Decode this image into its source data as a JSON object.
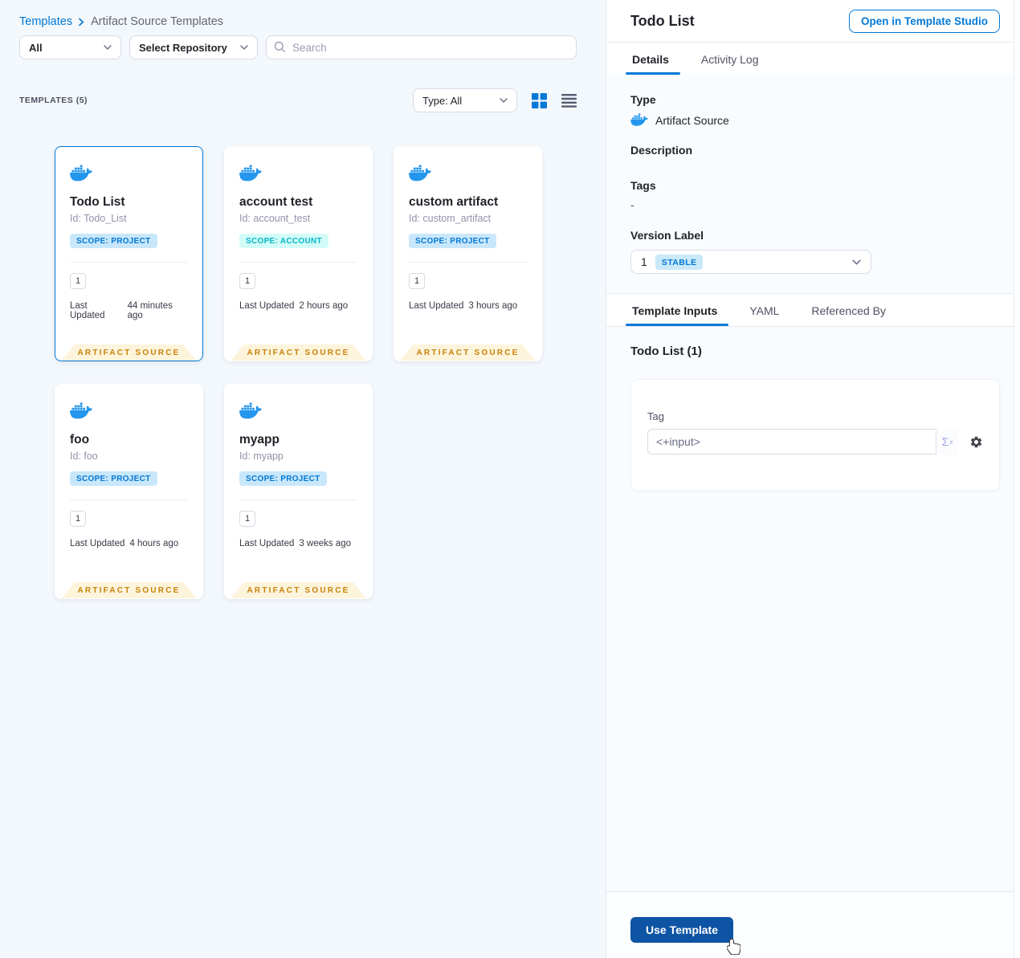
{
  "breadcrumb": {
    "link": "Templates",
    "current": "Artifact Source Templates"
  },
  "filters": {
    "scope_value": "All",
    "repository_value": "Select Repository",
    "search_placeholder": "Search"
  },
  "list_header": {
    "count": "TEMPLATES (5)",
    "type_filter": "Type: All"
  },
  "cards_common": {
    "last_updated_label": "Last Updated",
    "ribbon": "ARTIFACT SOURCE"
  },
  "cards": [
    {
      "title": "Todo List",
      "id": "Id: Todo_List",
      "scope": "SCOPE: PROJECT",
      "scope_type": "project",
      "version_count": "1",
      "last_updated": "44 minutes ago",
      "selected": true
    },
    {
      "title": "account test",
      "id": "Id: account_test",
      "scope": "SCOPE: ACCOUNT",
      "scope_type": "account",
      "version_count": "1",
      "last_updated": "2 hours ago",
      "selected": false
    },
    {
      "title": "custom artifact",
      "id": "Id: custom_artifact",
      "scope": "SCOPE: PROJECT",
      "scope_type": "project",
      "version_count": "1",
      "last_updated": "3 hours ago",
      "selected": false
    },
    {
      "title": "foo",
      "id": "Id: foo",
      "scope": "SCOPE: PROJECT",
      "scope_type": "project",
      "version_count": "1",
      "last_updated": "4 hours ago",
      "selected": false
    },
    {
      "title": "myapp",
      "id": "Id: myapp",
      "scope": "SCOPE: PROJECT",
      "scope_type": "project",
      "version_count": "1",
      "last_updated": "3 weeks ago",
      "selected": false
    }
  ],
  "panel": {
    "title": "Todo List",
    "open_button": "Open in Template Studio",
    "tabs": [
      "Details",
      "Activity Log"
    ],
    "details": {
      "type_label": "Type",
      "type_value": "Artifact Source",
      "description_label": "Description",
      "tags_label": "Tags",
      "tags_value": "-",
      "version_label": "Version Label",
      "version_value": "1",
      "version_badge": "STABLE"
    },
    "sub_tabs": [
      "Template Inputs",
      "YAML",
      "Referenced By"
    ],
    "inputs": {
      "heading": "Todo List (1)",
      "tag_label": "Tag",
      "tag_placeholder": "<+input>",
      "expression_sigma": "Σ",
      "expression_sup": "x"
    },
    "footer": {
      "use_template_label": "Use Template"
    }
  },
  "colors": {
    "primary_blue": "#0278d5",
    "docker_blue": "#2496ed",
    "use_template_button": "#0e54a4",
    "ribbon_bg": "#fdf4dc",
    "ribbon_text": "#c8830a",
    "scope_project_bg": "#c9e7fa",
    "scope_project_text": "#0278d5",
    "scope_account_bg": "#d3fcf8",
    "scope_account_text": "#06b7c4",
    "stable_badge_bg": "#c9e9f8",
    "stable_badge_text": "#0278d5",
    "left_background": "#f3f8fc",
    "right_background": "#f9fcff"
  }
}
